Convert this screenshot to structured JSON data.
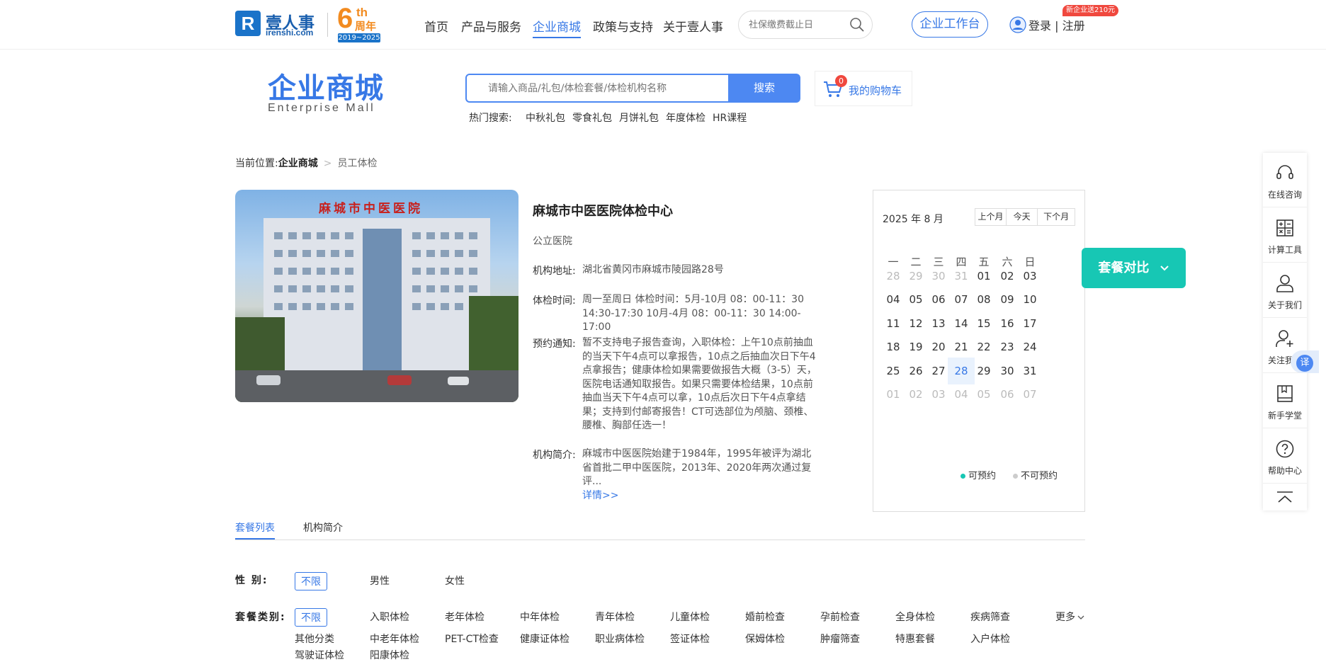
{
  "header": {
    "logo_letter": "R",
    "logo_name": "壹人事",
    "logo_domain": "irenshi.com",
    "anniversary_num": "6",
    "anniversary_th": "th",
    "anniversary_zh": "周年",
    "anniversary_years": "2019~2025",
    "nav": [
      "首页",
      "产品与服务",
      "企业商城",
      "政策与支持",
      "关于壹人事"
    ],
    "nav_active": "企业商城",
    "search_placeholder": "社保缴费截止日",
    "workbench_label": "企业工作台",
    "new_badge": "新企业送210元",
    "login_label": "登录",
    "register_label": "注册"
  },
  "mall": {
    "title": "企业商城",
    "subtitle": "Enterprise Mall",
    "search_placeholder": "请输入商品/礼包/体检套餐/体检机构名称",
    "search_button": "搜索",
    "cart_count": "0",
    "cart_label": "我的购物车",
    "hot_label": "热门搜索:",
    "hot_items": [
      "中秋礼包",
      "零食礼包",
      "月饼礼包",
      "年度体检",
      "HR课程"
    ]
  },
  "breadcrumb": {
    "prefix": "当前位置:",
    "level1": "企业商城",
    "level2": "员工体检"
  },
  "hospital": {
    "photo_sign": "麻城市中医医院",
    "name": "麻城市中医医院体检中心",
    "type": "公立医院",
    "address_label": "机构地址:",
    "address": "湖北省黄冈市麻城市陵园路28号",
    "hours_label": "体检时间:",
    "hours": "周一至周日 体检时间：5月-10月 08：00-11：30 14:30-17:30 10月-4月 08：00-11：30 14:00-17:00",
    "notice_label": "预约通知:",
    "notice": "暂不支持电子报告查询，入职体检：上午10点前抽血的当天下午4点可以拿报告，10点之后抽血次日下午4点拿报告；健康体检如果需要做报告大概（3-5）天，医院电话通知取报告。如果只需要体检结果，10点前抽血当天下午4点可以拿，10点后次日下午4点拿结果；支持到付邮寄报告！CT可选部位为颅脑、颈椎、腰椎、胸部任选一！",
    "intro_label": "机构简介:",
    "intro": "麻城市中医医院始建于1984年，1995年被评为湖北省首批二甲中医医院，2013年、2020年两次通过复评...",
    "detail_link": "详情>>"
  },
  "calendar": {
    "year_month": "2025 年 8 月",
    "btn_prev": "上个月",
    "btn_today": "今天",
    "btn_next": "下个月",
    "weekdays": [
      "一",
      "二",
      "三",
      "四",
      "五",
      "六",
      "日"
    ],
    "weeks": [
      [
        "28",
        "29",
        "30",
        "31",
        "01",
        "02",
        "03"
      ],
      [
        "04",
        "05",
        "06",
        "07",
        "08",
        "09",
        "10"
      ],
      [
        "11",
        "12",
        "13",
        "14",
        "15",
        "16",
        "17"
      ],
      [
        "18",
        "19",
        "20",
        "21",
        "22",
        "23",
        "24"
      ],
      [
        "25",
        "26",
        "27",
        "28",
        "29",
        "30",
        "31"
      ],
      [
        "01",
        "02",
        "03",
        "04",
        "05",
        "06",
        "07"
      ]
    ],
    "today_value": "28",
    "legend_available": "可预约",
    "legend_unavailable": "不可预约",
    "color_available": "#17c7b4",
    "color_unavailable": "#cccccc"
  },
  "compare_button": "套餐对比",
  "tabs": [
    "套餐列表",
    "机构简介"
  ],
  "filters": {
    "gender_label": "性 别:",
    "gender_options": [
      "不限",
      "男性",
      "女性"
    ],
    "category_label": "套餐类别:",
    "category_row1": [
      "不限",
      "入职体检",
      "老年体检",
      "中年体检",
      "青年体检",
      "儿童体检",
      "婚前检查",
      "孕前检查",
      "全身体检",
      "疾病筛查"
    ],
    "category_row2": [
      "其他分类",
      "中老年体检",
      "PET-CT检查",
      "健康证体检",
      "职业病体检",
      "签证体检",
      "保姆体检",
      "肿瘤筛查",
      "特惠套餐",
      "入户体检"
    ],
    "category_row3": [
      "驾驶证体检",
      "阳康体检"
    ],
    "more_label": "更多"
  },
  "sidebar": [
    "在线咨询",
    "计算工具",
    "关于我们",
    "关注我们",
    "新手学堂",
    "帮助中心"
  ],
  "translate_label": "译",
  "accent_color": "#3778e6"
}
